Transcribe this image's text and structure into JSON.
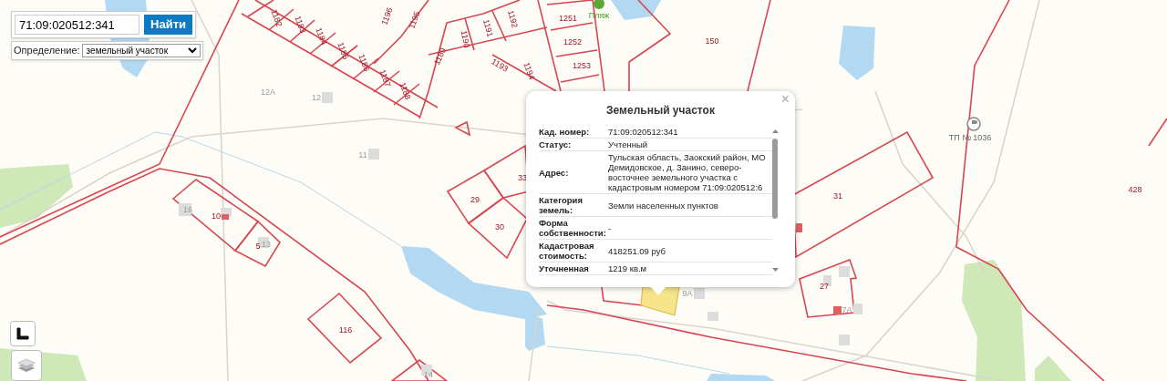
{
  "search": {
    "value": "71:09:020512:341",
    "button": "Найти"
  },
  "definition": {
    "label": "Определение:",
    "value": "земельный участок"
  },
  "popup": {
    "title": "Земельный участок",
    "close": "×",
    "rows": [
      {
        "label": "Кад. номер:",
        "value": "71:09:020512:341"
      },
      {
        "label": "Статус:",
        "value": "Учтенный"
      },
      {
        "label": "Адрес:",
        "value": "Тульская область, Заокский район, МО Демидовское, д. Занино, северо-восточнее земельного участка с кадастровым номером 71:09:020512:6"
      },
      {
        "label": "Категория земель:",
        "value": "Земли населенных пунктов"
      },
      {
        "label": "Форма собственности:",
        "value": "-"
      },
      {
        "label": "Кадастровая стоимость:",
        "value": "418251.09 руб"
      },
      {
        "label": "Уточненная",
        "value": "1219 кв.м"
      }
    ]
  },
  "map_labels": [
    {
      "text": "1182",
      "kind": "parcel"
    },
    {
      "text": "1183",
      "kind": "parcel"
    },
    {
      "text": "1184",
      "kind": "parcel"
    },
    {
      "text": "1185",
      "kind": "parcel"
    },
    {
      "text": "1186",
      "kind": "parcel"
    },
    {
      "text": "1187",
      "kind": "parcel"
    },
    {
      "text": "1188",
      "kind": "parcel"
    },
    {
      "text": "1189",
      "kind": "parcel"
    },
    {
      "text": "1190",
      "kind": "parcel"
    },
    {
      "text": "1191",
      "kind": "parcel"
    },
    {
      "text": "1192",
      "kind": "parcel"
    },
    {
      "text": "1193",
      "kind": "parcel"
    },
    {
      "text": "1194",
      "kind": "parcel"
    },
    {
      "text": "1195",
      "kind": "parcel"
    },
    {
      "text": "1196",
      "kind": "parcel"
    },
    {
      "text": "1251",
      "kind": "parcel"
    },
    {
      "text": "1252",
      "kind": "parcel"
    },
    {
      "text": "1253",
      "kind": "parcel"
    },
    {
      "text": "150",
      "kind": "parcel"
    },
    {
      "text": "Пляж",
      "kind": "poi"
    },
    {
      "text": "12А",
      "kind": "building"
    },
    {
      "text": "12",
      "kind": "building"
    },
    {
      "text": "11",
      "kind": "building"
    },
    {
      "text": "16",
      "kind": "building"
    },
    {
      "text": "10",
      "kind": "parcel"
    },
    {
      "text": "5",
      "kind": "parcel"
    },
    {
      "text": "13",
      "kind": "building"
    },
    {
      "text": "29",
      "kind": "parcel"
    },
    {
      "text": "30",
      "kind": "parcel"
    },
    {
      "text": "33",
      "kind": "parcel"
    },
    {
      "text": "116",
      "kind": "parcel"
    },
    {
      "text": "14",
      "kind": "building"
    },
    {
      "text": "31",
      "kind": "parcel"
    },
    {
      "text": "428",
      "kind": "parcel"
    },
    {
      "text": "ТП № 1036",
      "kind": "facility"
    },
    {
      "text": "27",
      "kind": "parcel"
    },
    {
      "text": "9А",
      "kind": "building"
    },
    {
      "text": "7А",
      "kind": "building"
    }
  ]
}
